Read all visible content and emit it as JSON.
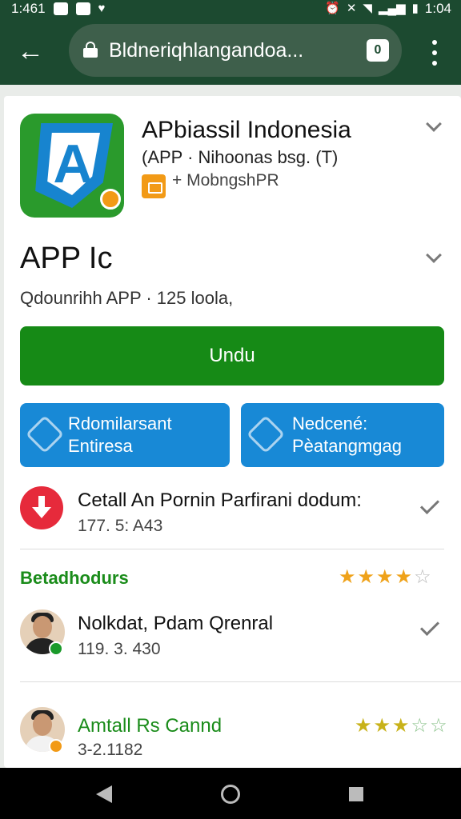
{
  "status_bar": {
    "time_left": "1:461",
    "time_right": "1:04"
  },
  "toolbar": {
    "url": "Bldneriqhlangandoa...",
    "tab_count": "0"
  },
  "app": {
    "title": "APbiassil Indonesia",
    "subtitle": "(APP · Nihoonas bsg. (T)",
    "developer": "+ MobngshPR"
  },
  "section": {
    "title": "APP Ic",
    "meta": "Qdounrihh APP · 125 loola,"
  },
  "install_button": {
    "label": "Undu"
  },
  "action_buttons": [
    {
      "line1": "Rdomilarsant",
      "line2": "Entiresa",
      "icon": "shield-icon"
    },
    {
      "line1": "Nedcené:",
      "line2": "Pèatangmgag",
      "icon": "sparkle-icon"
    }
  ],
  "download_row": {
    "title": "Cetall An Pornin Parfirani dodum:",
    "sub": "177. 5: A43"
  },
  "ratings_section": {
    "heading": "Betadhodurs",
    "stars": 3.5
  },
  "reviews": [
    {
      "name": "Nolkdat, Pdam Qrenral",
      "sub": "119. 3. 430",
      "badge_color": "#1a9a2a"
    },
    {
      "name": "Amtall Rs Cannd",
      "sub": "3-2.1182",
      "stars": 3.5,
      "badge_color": "#f29a16"
    }
  ],
  "colors": {
    "toolbar": "#1c4a30",
    "install": "#168a16",
    "action": "#1889d6",
    "alert": "#e62a3b"
  }
}
